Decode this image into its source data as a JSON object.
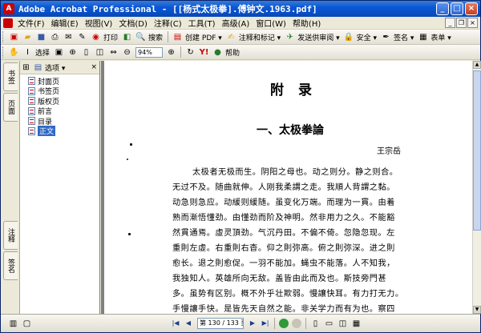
{
  "window": {
    "title": "Adobe Acrobat Professional - [[杨式太极拳].傅钟文.1963.pdf]",
    "app_icon": "acrobat-icon",
    "controls": [
      "_",
      "□",
      "×"
    ]
  },
  "menubar": {
    "items": [
      "文件(F)",
      "编辑(E)",
      "视图(V)",
      "文档(D)",
      "注释(C)",
      "工具(T)",
      "高级(A)",
      "窗口(W)",
      "帮助(H)"
    ]
  },
  "toolbar1": {
    "search_label": "搜索",
    "buttons": [
      "创建 PDF ▾",
      "注释和标记 ▾",
      "发送供审阅 ▾",
      "安全 ▾",
      "签名 ▾",
      "表单 ▾"
    ],
    "print_label": "打印"
  },
  "toolbar2": {
    "select_label": "选择",
    "zoom_value": "94%",
    "help_label": "帮助"
  },
  "side_tabs": {
    "bookmarks": "书签",
    "pages": "页面",
    "comments": "注释",
    "signatures": "签名"
  },
  "bookmarks": {
    "options_label": "选项 ▾",
    "items": [
      {
        "label": "封面页"
      },
      {
        "label": "书签页"
      },
      {
        "label": "版权页"
      },
      {
        "label": "前言"
      },
      {
        "label": "目录"
      },
      {
        "label": "正文"
      }
    ]
  },
  "document": {
    "heading": "附录",
    "chapter": "一、太极拳論",
    "author": "王宗岳",
    "lines": [
      "太极者无极而生。阴阳之母也。动之则分。静之则合。",
      "无过不及。随曲就伸。人刚我柔謂之走。我順人背謂之黏。",
      "动急则急应。动緩则緩随。虽变化万端。而理为一貫。由着",
      "熟而漸悟懂劲。由懂劲而阶及神明。然非用力之久。不能豁",
      "然貫通焉。虛灵頂劲。气沉丹田。不偏不倚。忽隐忽现。左",
      "重則左虛。右重則右杳。仰之則弥高。俯之則弥深。进之則",
      "愈长。退之則愈促。一羽不能加。蝇虫不能落。人不知我，",
      "我独知人。英雄所向无敌。盖皆由此而及也。斯技旁門甚",
      "多。虽势有区别。概不外乎壮欺弱。慢讓快耳。有力打无力。",
      "手慢讓手快。是皆先天自然之能。非关学力而有为也。察四"
    ]
  },
  "statusbar": {
    "page_field": "第 130 / 133 页"
  },
  "colors": {
    "titlebar": "#0a58d6",
    "selection": "#316ac5",
    "doc_background": "#808080"
  }
}
